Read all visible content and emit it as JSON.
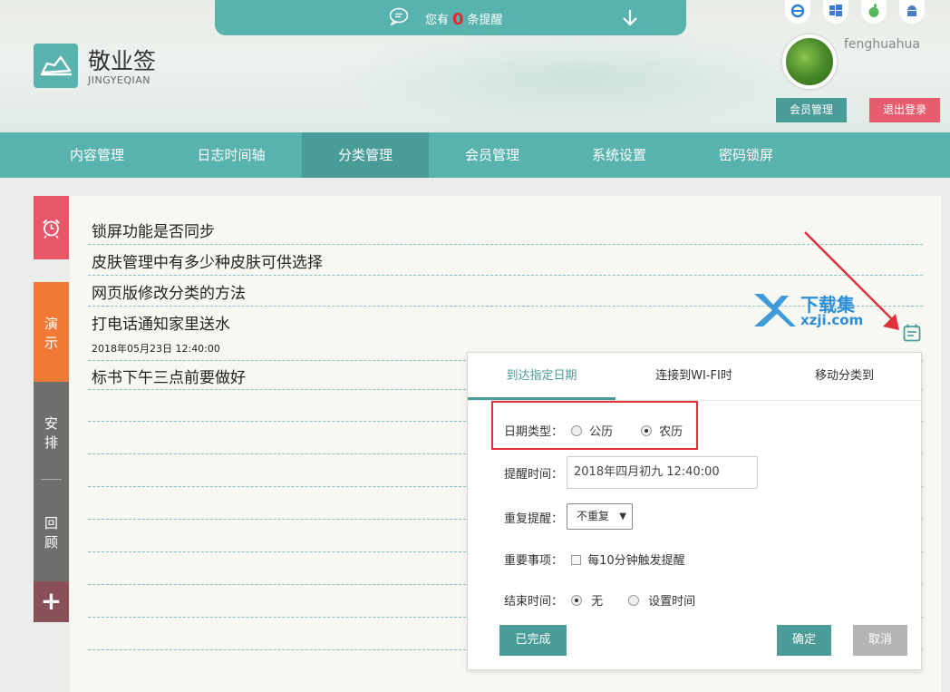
{
  "header": {
    "notice_prefix": "您有",
    "notice_count": "0",
    "notice_suffix": "条提醒",
    "brand_name": "敬业签",
    "brand_pinyin": "JINGYEQIAN",
    "username": "fenghuahua",
    "member_button": "会员管理",
    "logout_button": "退出登录",
    "os_icons": [
      "ie-icon",
      "windows-icon",
      "apple-icon",
      "android-icon"
    ]
  },
  "nav": {
    "items": [
      {
        "label": "内容管理"
      },
      {
        "label": "日志时间轴"
      },
      {
        "label": "分类管理"
      },
      {
        "label": "会员管理"
      },
      {
        "label": "系统设置"
      },
      {
        "label": "密码锁屏"
      }
    ],
    "active_index": 2
  },
  "side": {
    "demo": "演示",
    "plan": "安排",
    "review": "回顾",
    "add": "+"
  },
  "notes": [
    {
      "text": "锁屏功能是否同步"
    },
    {
      "text": "皮肤管理中有多少种皮肤可供选择"
    },
    {
      "text": "网页版修改分类的方法"
    },
    {
      "text": "打电话通知家里送水",
      "date": "2018年05月23日 12:40:00"
    },
    {
      "text": "标书下午三点前要做好"
    }
  ],
  "watermark": {
    "line1": "下载集",
    "line2": "xzji.com"
  },
  "popup": {
    "tabs": [
      {
        "label": "到达指定日期"
      },
      {
        "label": "连接到WI-FI时"
      },
      {
        "label": "移动分类到"
      }
    ],
    "active_tab": 0,
    "date_type_label": "日期类型：",
    "date_type_options": [
      "公历",
      "农历"
    ],
    "date_type_selected": "农历",
    "remind_time_label": "提醒时间：",
    "remind_time_value": "2018年四月初九 12:40:00",
    "repeat_label": "重复提醒：",
    "repeat_value": "不重复",
    "important_label": "重要事项：",
    "important_option": "每10分钟触发提醒",
    "end_time_label": "结束时间：",
    "end_time_options": [
      "无",
      "设置时间"
    ],
    "end_time_selected": "无",
    "done_button": "已完成",
    "confirm_button": "确定",
    "cancel_button": "取消"
  },
  "colors": {
    "primary": "#58b2ad",
    "primary_dark": "#4a9c98",
    "alarm_tab": "#e8566a",
    "demo_tab": "#f07a35",
    "plan_tab": "#6e6e6e",
    "add_tab": "#8a5058",
    "logout": "#e85c6f",
    "highlight": "#e0303a",
    "watermark": "#2c8fd6"
  }
}
